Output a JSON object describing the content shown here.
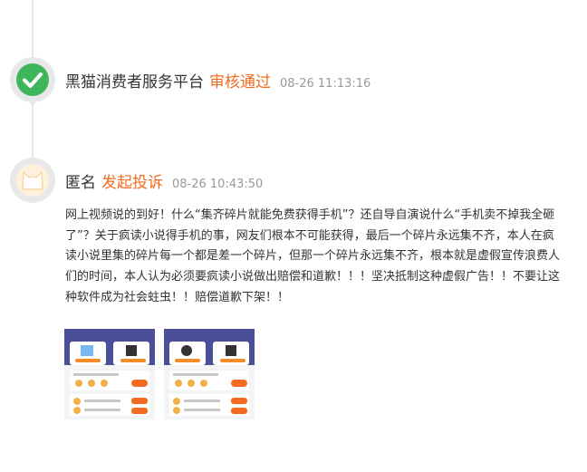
{
  "entries": [
    {
      "name": "黑猫消费者服务平台",
      "status": "审核通过",
      "time": "08-26 11:13:16",
      "icon": "check-icon"
    },
    {
      "name": "匿名",
      "status": "发起投诉",
      "time": "08-26 10:43:50",
      "icon": "cat-avatar-icon",
      "text": "网上视频说的到好！什么“集齐碎片就能免费获得手机”？还自导自演说什么“手机卖不掉我全砸了”？关于疯读小说得手机的事，网友们根本不可能获得，最后一个碎片永远集不齐，本人在疯读小说里集的碎片每一个都是差一个碎片，但那一个碎片永远集不齐，根本就是虚假宣传浪费人们的时间，本人认为必须要疯读小说做出赔偿和道歉！！！坚决抵制这种虚假广告！！不要让这种软件成为社会蛀虫！！赔偿道歉下架！！",
      "attachments": [
        "screenshot-thumbnail",
        "screenshot-thumbnail"
      ]
    }
  ],
  "colors": {
    "accent": "#f26b21",
    "check": "#3fb55b",
    "muted": "#999999",
    "line": "#e6e6e6"
  }
}
